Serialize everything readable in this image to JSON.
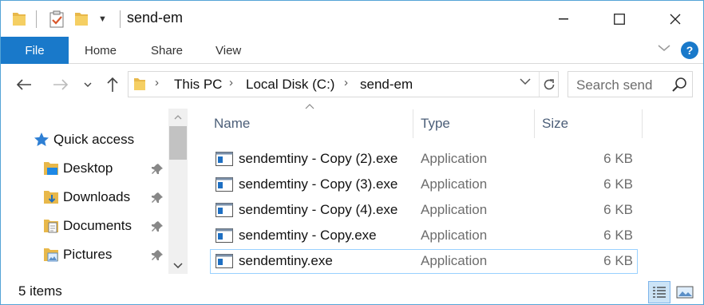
{
  "window": {
    "title": "send-em",
    "controls": {
      "minimize": "—",
      "maximize": "☐",
      "close": "✕"
    }
  },
  "ribbon": {
    "tabs": [
      {
        "label": "File"
      },
      {
        "label": "Home"
      },
      {
        "label": "Share"
      },
      {
        "label": "View"
      }
    ],
    "help_label": "?"
  },
  "nav": {
    "back": "←",
    "forward": "→",
    "recent": "⌄",
    "up": "↑"
  },
  "address": {
    "crumbs": [
      "This PC",
      "Local Disk (C:)",
      "send-em"
    ],
    "separator": "›",
    "refresh": "↻",
    "dropdown": "∨"
  },
  "search": {
    "placeholder": "Search send"
  },
  "navpane": {
    "items": [
      {
        "label": "Quick access",
        "icon": "star-icon"
      },
      {
        "label": "Desktop",
        "icon": "desktop-folder-icon",
        "pinned": true
      },
      {
        "label": "Downloads",
        "icon": "downloads-folder-icon",
        "pinned": true
      },
      {
        "label": "Documents",
        "icon": "documents-folder-icon",
        "pinned": true
      },
      {
        "label": "Pictures",
        "icon": "pictures-folder-icon",
        "pinned": true
      }
    ]
  },
  "filelist": {
    "columns": {
      "name": "Name",
      "type": "Type",
      "size": "Size"
    },
    "rows": [
      {
        "name": "sendemtiny - Copy (2).exe",
        "type": "Application",
        "size": "6 KB"
      },
      {
        "name": "sendemtiny - Copy (3).exe",
        "type": "Application",
        "size": "6 KB"
      },
      {
        "name": "sendemtiny - Copy (4).exe",
        "type": "Application",
        "size": "6 KB"
      },
      {
        "name": "sendemtiny - Copy.exe",
        "type": "Application",
        "size": "6 KB"
      },
      {
        "name": "sendemtiny.exe",
        "type": "Application",
        "size": "6 KB"
      }
    ]
  },
  "status": {
    "items_count": "5 items"
  },
  "colors": {
    "accent": "#1979ca",
    "border": "#54a3d6",
    "selected_border": "#99d1ff",
    "folder": "#e8b84a"
  }
}
